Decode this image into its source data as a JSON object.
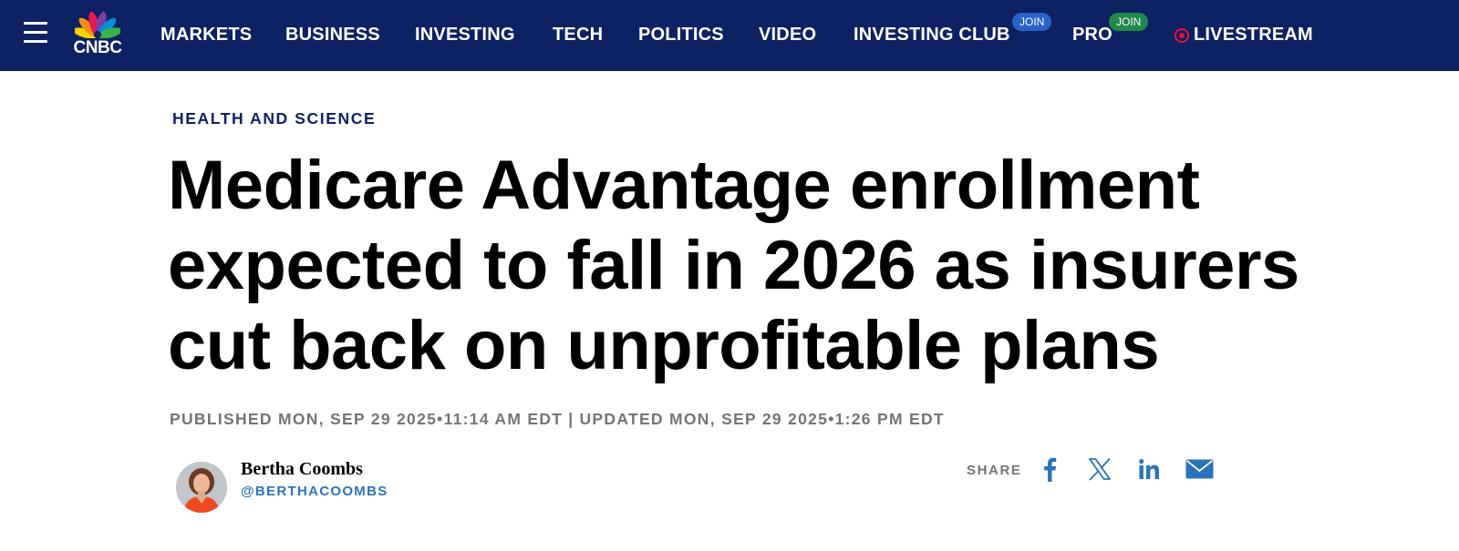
{
  "nav": {
    "logo_text": "CNBC",
    "items": [
      {
        "label": "MARKETS"
      },
      {
        "label": "BUSINESS"
      },
      {
        "label": "INVESTING"
      },
      {
        "label": "TECH"
      },
      {
        "label": "POLITICS"
      },
      {
        "label": "VIDEO"
      },
      {
        "label": "INVESTING CLUB",
        "badge": "JOIN"
      },
      {
        "label": "PRO",
        "badge": "JOIN"
      },
      {
        "label": "LIVESTREAM"
      }
    ],
    "colors": {
      "background": "#0d2163",
      "badge_club": "#2a62c9",
      "badge_pro": "#1e8a4c",
      "live": "#e8123d"
    }
  },
  "article": {
    "section": "HEALTH AND SCIENCE",
    "headline_lines": [
      "Medicare Advantage enrollment",
      "expected to fall in 2026 as insurers",
      "cut back on unprofitable plans"
    ],
    "published": "PUBLISHED MON, SEP 29 2025•11:14 AM EDT",
    "separator": "|",
    "updated": "UPDATED MON, SEP 29 2025•1:26 PM EDT",
    "author": {
      "name": "Bertha Coombs",
      "handle": "@BERTHACOOMBS"
    },
    "share": {
      "label": "SHARE",
      "icons": [
        "facebook-icon",
        "x-icon",
        "linkedin-icon",
        "email-icon"
      ],
      "icon_color": "#2b73b8"
    }
  }
}
